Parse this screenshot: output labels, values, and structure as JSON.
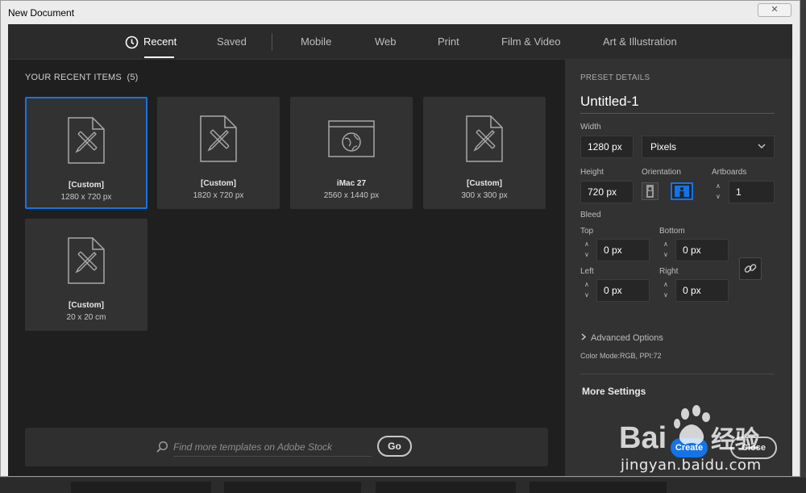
{
  "window": {
    "title": "New Document",
    "close_glyph": "✕"
  },
  "tabs": [
    {
      "label": "Recent",
      "active": true,
      "icon": "clock-icon"
    },
    {
      "label": "Saved"
    },
    {
      "label": "Mobile"
    },
    {
      "label": "Web"
    },
    {
      "label": "Print"
    },
    {
      "label": "Film & Video"
    },
    {
      "label": "Art & Illustration"
    }
  ],
  "recent": {
    "title": "YOUR RECENT ITEMS",
    "count": "(5)",
    "items": [
      {
        "name": "[Custom]",
        "size": "1280 x 720 px",
        "icon": "custom-document-icon",
        "selected": true
      },
      {
        "name": "[Custom]",
        "size": "1820 x 720 px",
        "icon": "custom-document-icon"
      },
      {
        "name": "iMac 27",
        "size": "2560 x 1440 px",
        "icon": "web-browser-icon"
      },
      {
        "name": "[Custom]",
        "size": "300 x 300 px",
        "icon": "custom-document-icon"
      },
      {
        "name": "[Custom]",
        "size": "20 x 20 cm",
        "icon": "custom-document-icon"
      }
    ]
  },
  "search": {
    "placeholder": "Find more templates on Adobe Stock",
    "go_label": "Go"
  },
  "preset": {
    "header": "PRESET DETAILS",
    "name": "Untitled-1",
    "width_label": "Width",
    "width_value": "1280 px",
    "unit": "Pixels",
    "height_label": "Height",
    "height_value": "720 px",
    "orientation_label": "Orientation",
    "orientation_selected": "landscape",
    "artboards_label": "Artboards",
    "artboards_value": "1",
    "bleed_label": "Bleed",
    "top_label": "Top",
    "top_value": "0 px",
    "bottom_label": "Bottom",
    "bottom_value": "0 px",
    "left_label": "Left",
    "left_value": "0 px",
    "right_label": "Right",
    "right_value": "0 px",
    "advanced_label": "Advanced Options",
    "color_mode": "Color Mode:RGB, PPI:72",
    "more_settings": "More Settings"
  },
  "actions": {
    "create_label": "Create",
    "close_label": "Close"
  },
  "watermark": {
    "logo_text": "Bai经验",
    "url_text": "jingyan.baidu.com"
  },
  "colors": {
    "accent": "#1473e6",
    "panel": "#323232",
    "background": "#1f1f1f"
  }
}
